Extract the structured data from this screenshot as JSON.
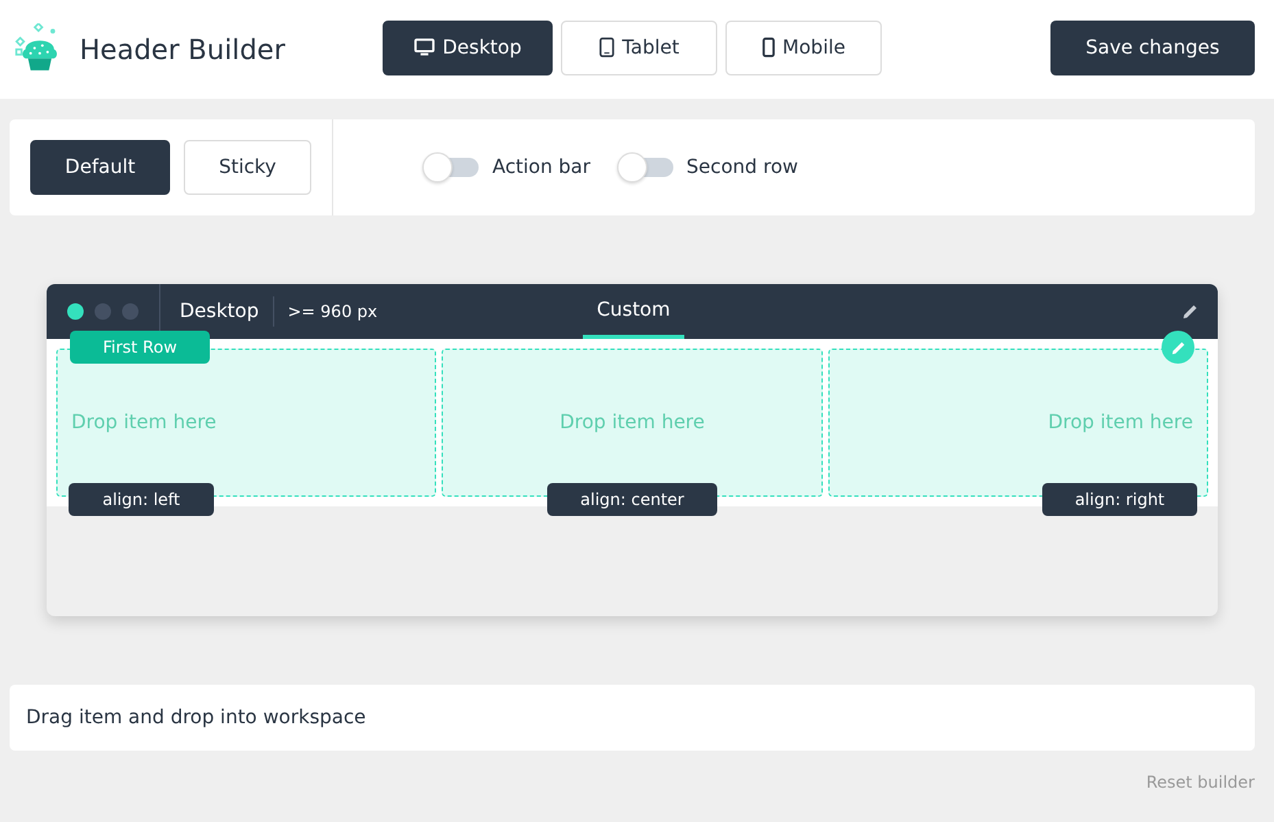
{
  "app": {
    "title": "Header Builder"
  },
  "devices": [
    {
      "label": "Desktop",
      "kind": "desktop",
      "selected": true
    },
    {
      "label": "Tablet",
      "kind": "tablet",
      "selected": false
    },
    {
      "label": "Mobile",
      "kind": "mobile",
      "selected": false
    }
  ],
  "save_button": "Save changes",
  "modes": [
    {
      "label": "Default",
      "selected": true
    },
    {
      "label": "Sticky",
      "selected": false
    }
  ],
  "toggles": [
    {
      "label": "Action bar",
      "on": false
    },
    {
      "label": "Second row",
      "on": false
    }
  ],
  "preview": {
    "device": "Desktop",
    "breakpoint": ">= 960 px",
    "tabs": [
      {
        "label": "Custom",
        "selected": true
      }
    ],
    "row": {
      "label": "First Row",
      "columns": [
        {
          "placeholder": "Drop item here",
          "kind": "start",
          "badge": "align: left"
        },
        {
          "placeholder": "Drop item here",
          "kind": "middle",
          "badge": "align: center"
        },
        {
          "placeholder": "Drop item here",
          "kind": "end",
          "badge": "align: right"
        }
      ]
    }
  },
  "hint": "Drag item and drop into workspace",
  "reset_link": "Reset builder"
}
